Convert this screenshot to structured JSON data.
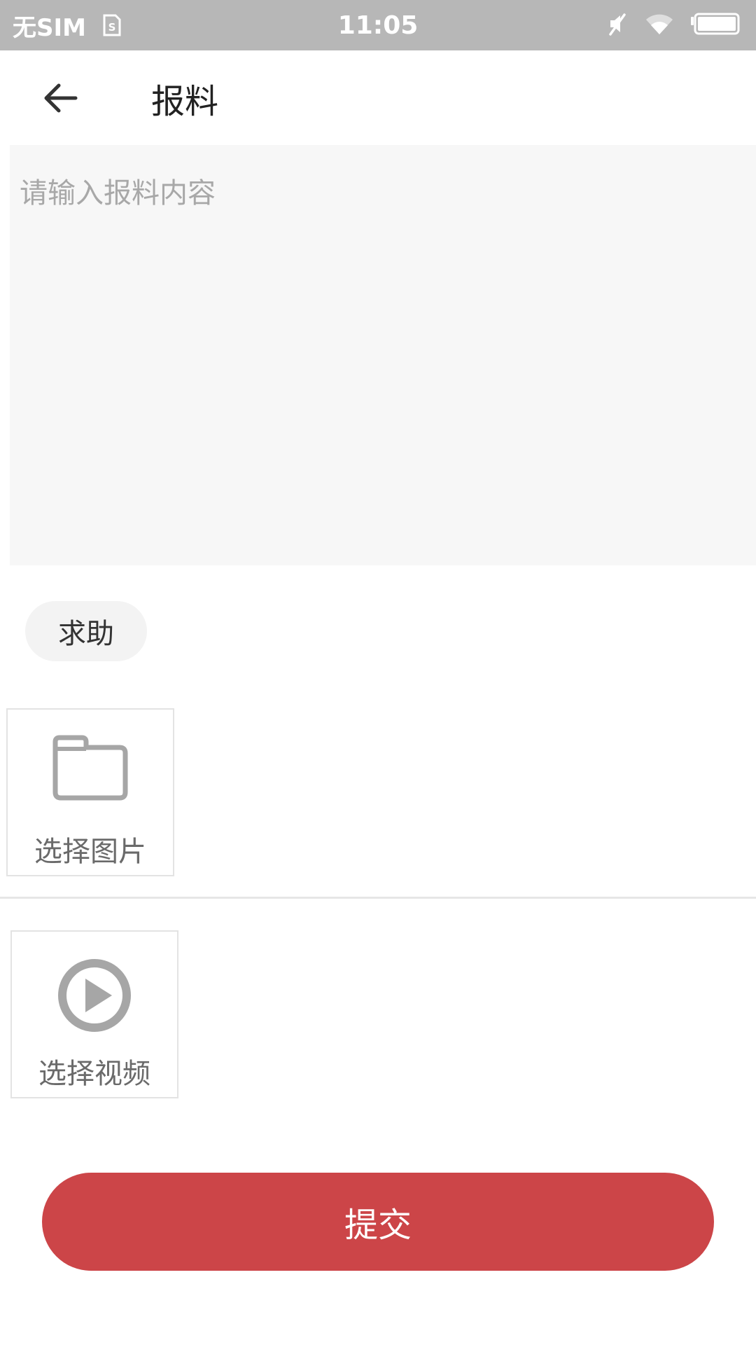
{
  "status_bar": {
    "carrier": "无SIM",
    "time": "11:05",
    "icons": [
      "sim-card-icon",
      "mute-icon",
      "wifi-icon",
      "battery-icon"
    ]
  },
  "header": {
    "back_icon": "arrow-left-icon",
    "title": "报料"
  },
  "content": {
    "value": "",
    "placeholder": "请输入报料内容"
  },
  "tags": [
    {
      "label": "求助"
    }
  ],
  "media": {
    "image": {
      "label": "选择图片",
      "icon": "folder-icon"
    },
    "video": {
      "label": "选择视频",
      "icon": "play-circle-icon"
    }
  },
  "actions": {
    "submit_label": "提交"
  },
  "colors": {
    "status_bar": "#b7b7b7",
    "accent": "#cc4548",
    "input_bg": "#f7f7f7",
    "icon_gray": "#a6a6a6"
  }
}
